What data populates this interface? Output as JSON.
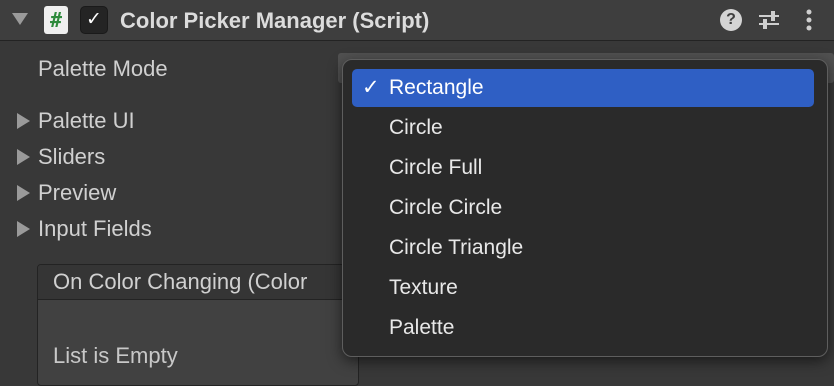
{
  "component": {
    "title": "Color Picker Manager (Script)",
    "script_icon_glyph": "#",
    "enabled_check": "✓",
    "help_glyph": "?"
  },
  "inspector": {
    "palette_mode_label": "Palette Mode",
    "foldouts": [
      {
        "label": "Palette UI"
      },
      {
        "label": "Sliders"
      },
      {
        "label": "Preview"
      },
      {
        "label": "Input Fields"
      }
    ],
    "event": {
      "header": "On Color Changing (Color",
      "empty_text": "List is Empty"
    }
  },
  "dropdown": {
    "selected_check": "✓",
    "selected_index": 0,
    "options": [
      "Rectangle",
      "Circle",
      "Circle Full",
      "Circle Circle",
      "Circle Triangle",
      "Texture",
      "Palette"
    ]
  },
  "colors": {
    "background": "#383838",
    "header": "#3e3e3e",
    "selection_accent": "#2f5fc4",
    "script_icon_green": "#2e8a3c",
    "menu_background": "#2a2a2a"
  },
  "icons": {
    "fold": "chevron-down-icon",
    "script": "csharp-script-icon",
    "toggle": "checkbox-checked-icon",
    "help": "help-icon",
    "presets": "presets-sliders-icon",
    "more": "more-vertical-icon"
  }
}
